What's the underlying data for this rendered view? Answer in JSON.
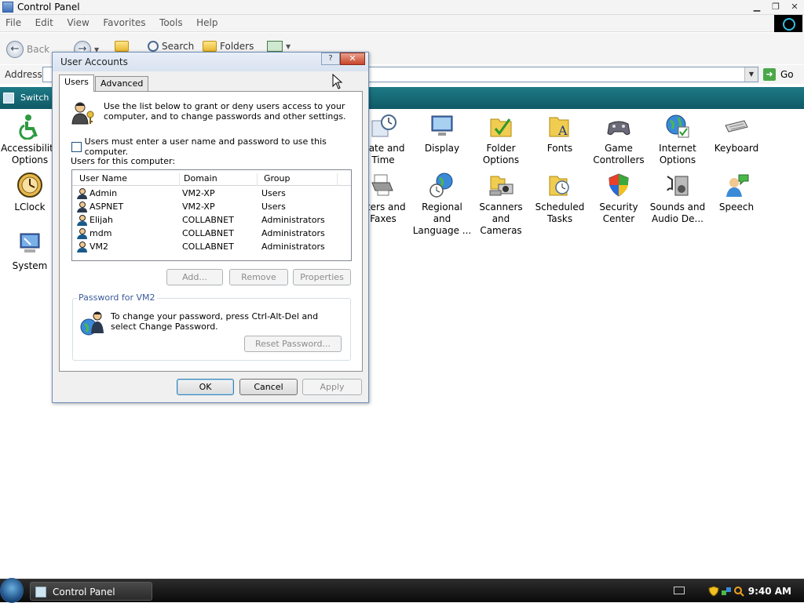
{
  "window": {
    "title": "Control Panel"
  },
  "menubar": [
    "File",
    "Edit",
    "View",
    "Favorites",
    "Tools",
    "Help"
  ],
  "toolbar": {
    "back_label": "Back",
    "search_label": "Search",
    "folders_label": "Folders"
  },
  "address": {
    "label": "Address",
    "go_label": "Go"
  },
  "taskpane": {
    "switch_label": "Switch t"
  },
  "cp_left": [
    {
      "label": "Accessibility Options",
      "icon": "accessibility-icon"
    },
    {
      "label": "LClock",
      "icon": "clock-icon"
    },
    {
      "label": "System",
      "icon": "system-icon"
    }
  ],
  "cp_row1": [
    {
      "label": "Date and Time",
      "icon": "date-time-icon"
    },
    {
      "label": "Display",
      "icon": "display-icon"
    },
    {
      "label": "Folder Options",
      "icon": "folder-options-icon"
    },
    {
      "label": "Fonts",
      "icon": "fonts-icon"
    },
    {
      "label": "Game Controllers",
      "icon": "gamepad-icon"
    },
    {
      "label": "Internet Options",
      "icon": "globe-icon"
    },
    {
      "label": "Keyboard",
      "icon": "keyboard-icon"
    }
  ],
  "cp_row2": [
    {
      "label": "nters and Faxes",
      "icon": "printer-icon"
    },
    {
      "label": "Regional and Language ...",
      "icon": "regional-icon"
    },
    {
      "label": "Scanners and Cameras",
      "icon": "scanner-icon"
    },
    {
      "label": "Scheduled Tasks",
      "icon": "scheduled-tasks-icon"
    },
    {
      "label": "Security Center",
      "icon": "shield-icon"
    },
    {
      "label": "Sounds and Audio De...",
      "icon": "speaker-icon"
    },
    {
      "label": "Speech",
      "icon": "speech-icon"
    }
  ],
  "dialog": {
    "title": "User Accounts",
    "tabs": [
      "Users",
      "Advanced"
    ],
    "intro": "Use the list below to grant or deny users access to your computer, and to change passwords and other settings.",
    "checkbox_label": "Users must enter a user name and password to use this computer.",
    "list_label": "Users for this computer:",
    "columns": [
      "User Name",
      "Domain",
      "Group"
    ],
    "rows": [
      {
        "name": "Admin",
        "domain": "VM2-XP",
        "group": "Users"
      },
      {
        "name": "ASPNET",
        "domain": "VM2-XP",
        "group": "Users"
      },
      {
        "name": "Elijah",
        "domain": "COLLABNET",
        "group": "Administrators"
      },
      {
        "name": "mdm",
        "domain": "COLLABNET",
        "group": "Administrators"
      },
      {
        "name": "VM2",
        "domain": "COLLABNET",
        "group": "Administrators"
      }
    ],
    "buttons": {
      "add": "Add...",
      "remove": "Remove",
      "properties": "Properties"
    },
    "password_group": "Password for VM2",
    "password_text": "To change your password, press Ctrl-Alt-Del and select Change Password.",
    "reset_button": "Reset Password...",
    "ok": "OK",
    "cancel": "Cancel",
    "apply": "Apply"
  },
  "taskbar": {
    "task_label": "Control Panel",
    "clock": "9:40 AM"
  }
}
